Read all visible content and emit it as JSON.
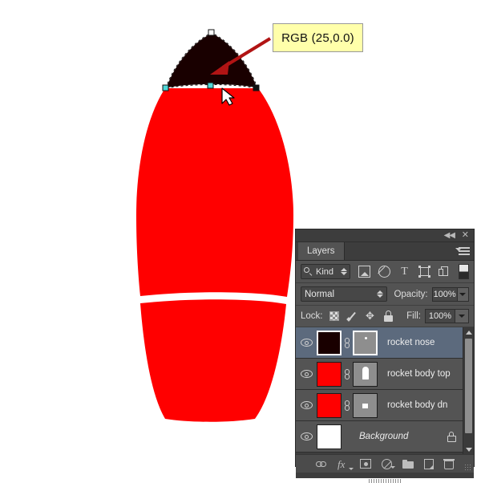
{
  "app": {
    "document_note": "Photoshop layers panel with rocket artwork"
  },
  "callout": {
    "label": "RGB (25,0.0)",
    "bg_color": "#ffffaa",
    "arrow_color": "#b11414"
  },
  "artwork": {
    "nose_color": "#190000",
    "body_color": "#ff0000",
    "background_color": "#ffffff",
    "anchor_color": "#4fd8d8",
    "path_outline_color": "#ffffff"
  },
  "panel": {
    "titlebar": {
      "collapse_label": "◀◀",
      "close_label": "✕"
    },
    "tab_label": "Layers",
    "filter": {
      "kind_label": "Kind",
      "icons": [
        "pixel-layer-filter-icon",
        "adjustment-layer-filter-icon",
        "type-layer-filter-icon",
        "shape-layer-filter-icon",
        "smart-object-filter-icon",
        "filter-toggle-switch"
      ],
      "type_glyph": "T"
    },
    "blend": {
      "mode": "Normal",
      "opacity_label": "Opacity:",
      "opacity_value": "100%"
    },
    "lock": {
      "label": "Lock:",
      "icons": [
        "lock-transparent-pixels-icon",
        "lock-image-pixels-icon",
        "lock-position-icon",
        "lock-all-icon"
      ],
      "fill_label": "Fill:",
      "fill_value": "100%"
    },
    "layers": [
      {
        "name": "rocket nose",
        "thumb_color": "#190000",
        "mask_color": "#8e8e8e",
        "has_mask": true,
        "linked": true,
        "selected": true,
        "visible": true,
        "locked": false,
        "italic": false,
        "mask_mark": "dot"
      },
      {
        "name": "rocket body top",
        "thumb_color": "#ff0000",
        "mask_color": "#8e8e8e",
        "has_mask": true,
        "linked": true,
        "selected": false,
        "visible": true,
        "locked": false,
        "italic": false,
        "mask_mark": "nose"
      },
      {
        "name": "rocket body dn",
        "thumb_color": "#ff0000",
        "mask_color": "#8e8e8e",
        "has_mask": true,
        "linked": true,
        "selected": false,
        "visible": true,
        "locked": false,
        "italic": false,
        "mask_mark": "square"
      },
      {
        "name": "Background",
        "thumb_color": "#ffffff",
        "has_mask": false,
        "linked": false,
        "selected": false,
        "visible": true,
        "locked": true,
        "italic": true,
        "mask_mark": "none"
      }
    ],
    "footer_icons": [
      "link-layers-icon",
      "layer-style-fx-icon",
      "add-layer-mask-icon",
      "new-adjustment-layer-icon",
      "new-group-icon",
      "new-layer-icon",
      "delete-layer-icon"
    ],
    "footer_fx_label": "fx"
  }
}
